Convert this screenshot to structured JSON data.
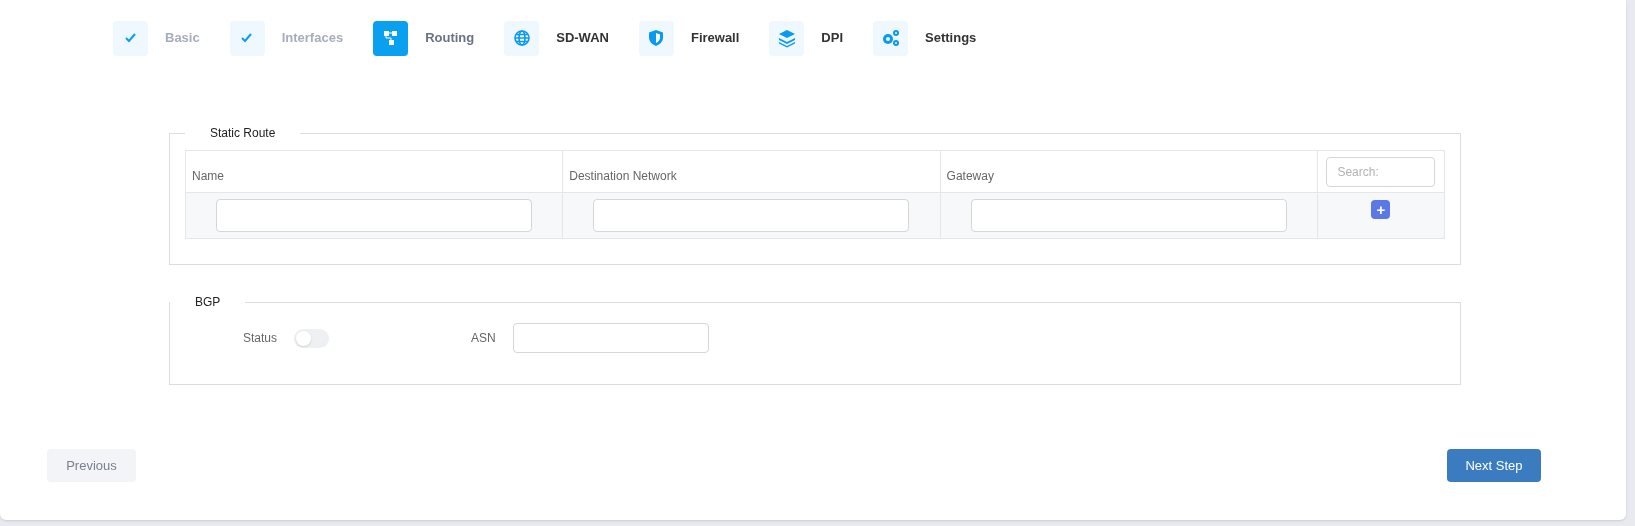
{
  "steps": [
    {
      "label": "Basic",
      "kind": "check",
      "completed": true,
      "selected": false
    },
    {
      "label": "Interfaces",
      "kind": "check",
      "completed": true,
      "selected": false
    },
    {
      "label": "Routing",
      "kind": "routing",
      "completed": false,
      "selected": true
    },
    {
      "label": "SD-WAN",
      "kind": "globe",
      "completed": false,
      "selected": false
    },
    {
      "label": "Firewall",
      "kind": "shield",
      "completed": false,
      "selected": false
    },
    {
      "label": "DPI",
      "kind": "layers",
      "completed": false,
      "selected": false
    },
    {
      "label": "Settings",
      "kind": "gears",
      "completed": false,
      "selected": false
    }
  ],
  "static_route": {
    "title": "Static Route",
    "columns": [
      "Name",
      "Destination Network",
      "Gateway"
    ],
    "search": {
      "placeholder": "Search:"
    },
    "add_button": "+"
  },
  "bgp": {
    "title": "BGP",
    "status": {
      "label": "Status",
      "on": false
    },
    "asn": {
      "label": "ASN"
    }
  },
  "buttons": {
    "previous": "Previous",
    "next": "Next Step"
  }
}
